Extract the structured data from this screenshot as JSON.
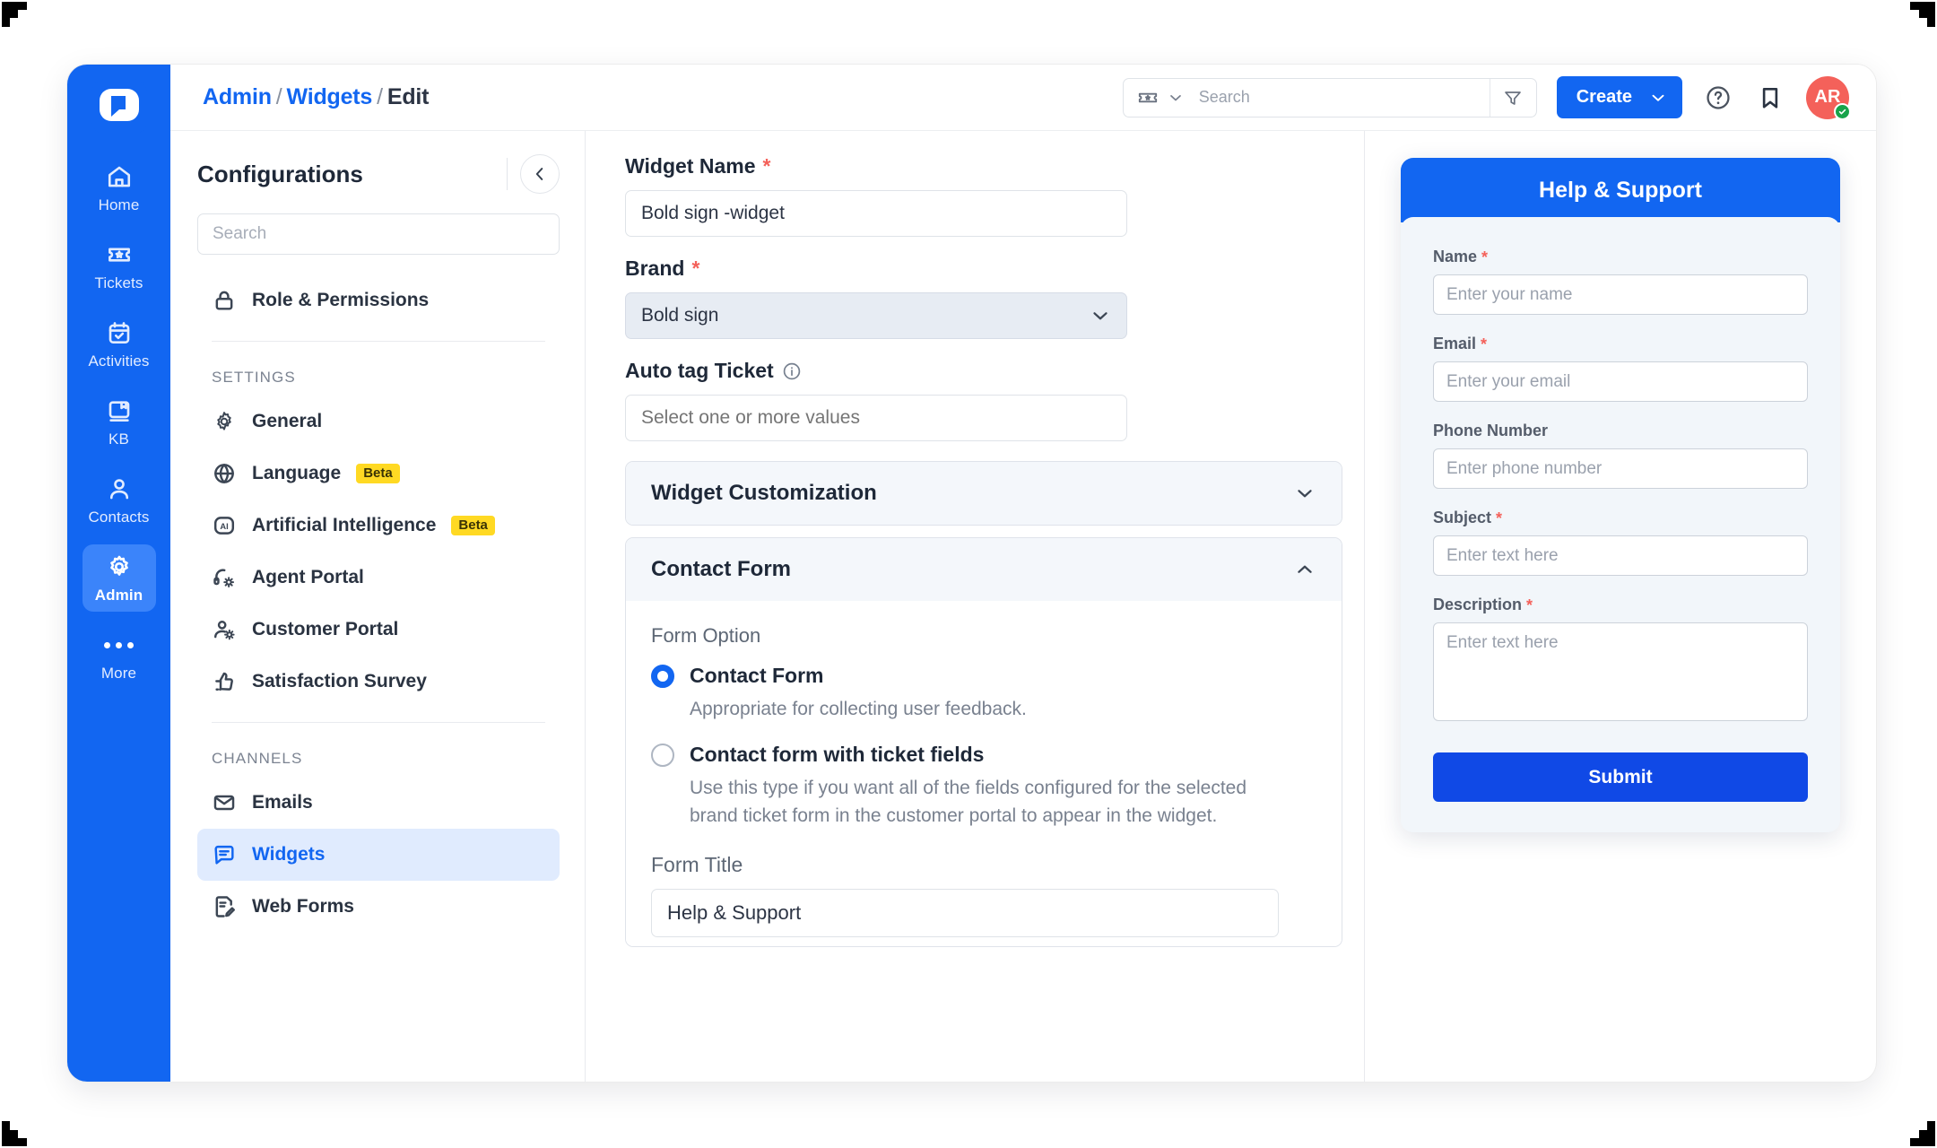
{
  "app": {
    "logo_icon": "chat-bubble-logo-icon",
    "accent_color": "#1266f1",
    "required_color": "#f4615a",
    "beta_badge_color": "#ffd923"
  },
  "rail": {
    "items": [
      {
        "label": "Home",
        "icon": "home-icon",
        "active": false
      },
      {
        "label": "Tickets",
        "icon": "ticket-icon",
        "active": false
      },
      {
        "label": "Activities",
        "icon": "calendar-check-icon",
        "active": false
      },
      {
        "label": "KB",
        "icon": "book-icon",
        "active": false
      },
      {
        "label": "Contacts",
        "icon": "person-icon",
        "active": false
      },
      {
        "label": "Admin",
        "icon": "gear-icon",
        "active": true
      },
      {
        "label": "More",
        "icon": "ellipsis-icon",
        "active": false
      }
    ]
  },
  "topbar": {
    "breadcrumb": {
      "root": "Admin",
      "section": "Widgets",
      "current": "Edit",
      "separator": "/"
    },
    "search": {
      "placeholder": "Search",
      "value": "",
      "type_icon": "ticket-icon",
      "type_chevron_icon": "chevron-down-icon",
      "filter_icon": "filter-icon"
    },
    "create_label": "Create",
    "create_chevron_icon": "chevron-down-icon",
    "help_icon": "question-circle-icon",
    "bookmark_icon": "bookmark-icon",
    "avatar": {
      "initials": "AR",
      "presence": "online",
      "presence_icon": "check-icon"
    }
  },
  "configurations": {
    "title": "Configurations",
    "collapse_icon": "chevron-left-icon",
    "search_placeholder": "Search",
    "search_value": "",
    "top_items": [
      {
        "label": "Role & Permissions",
        "icon": "lock-icon",
        "badge": null,
        "active": false
      }
    ],
    "groups": [
      {
        "title": "SETTINGS",
        "items": [
          {
            "label": "General",
            "icon": "gear-icon",
            "badge": null,
            "active": false
          },
          {
            "label": "Language",
            "icon": "globe-icon",
            "badge": "Beta",
            "active": false
          },
          {
            "label": "Artificial Intelligence",
            "icon": "ai-icon",
            "badge": "Beta",
            "active": false
          },
          {
            "label": "Agent Portal",
            "icon": "headset-gear-icon",
            "badge": null,
            "active": false
          },
          {
            "label": "Customer Portal",
            "icon": "person-gear-icon",
            "badge": null,
            "active": false
          },
          {
            "label": "Satisfaction Survey",
            "icon": "thumbs-up-icon",
            "badge": null,
            "active": false
          }
        ]
      },
      {
        "title": "CHANNELS",
        "items": [
          {
            "label": "Emails",
            "icon": "envelope-icon",
            "badge": null,
            "active": false
          },
          {
            "label": "Widgets",
            "icon": "chat-widget-icon",
            "badge": null,
            "active": true
          },
          {
            "label": "Web Forms",
            "icon": "form-edit-icon",
            "badge": null,
            "active": false
          }
        ]
      }
    ]
  },
  "form": {
    "widget_name": {
      "label": "Widget Name",
      "required": true,
      "value": "Bold sign -widget",
      "placeholder": ""
    },
    "brand": {
      "label": "Brand",
      "required": true,
      "value": "Bold sign",
      "chevron_icon": "chevron-down-icon"
    },
    "auto_tag": {
      "label": "Auto tag Ticket",
      "required": false,
      "info_icon": "info-icon",
      "value": "",
      "placeholder": "Select one or more values"
    },
    "accordions": [
      {
        "title": "Widget Customization",
        "expanded": false,
        "chevron_icon": "chevron-down-icon"
      },
      {
        "title": "Contact Form",
        "expanded": true,
        "chevron_icon": "chevron-up-icon"
      }
    ],
    "contact_form": {
      "form_option_label": "Form Option",
      "options": [
        {
          "title": "Contact Form",
          "desc": "Appropriate for collecting user feedback.",
          "selected": true
        },
        {
          "title": "Contact form with ticket fields",
          "desc": "Use this type if you want all of the fields configured for the selected brand ticket form in the customer portal to appear in the widget.",
          "selected": false
        }
      ],
      "form_title_label": "Form Title",
      "form_title_value": "Help & Support"
    }
  },
  "preview": {
    "header_title": "Help & Support",
    "fields": [
      {
        "label": "Name",
        "required": true,
        "placeholder": "Enter your name",
        "value": "",
        "type": "text"
      },
      {
        "label": "Email",
        "required": true,
        "placeholder": "Enter your email",
        "value": "",
        "type": "text"
      },
      {
        "label": "Phone Number",
        "required": false,
        "placeholder": "Enter phone number",
        "value": "",
        "type": "text"
      },
      {
        "label": "Subject",
        "required": true,
        "placeholder": "Enter text here",
        "value": "",
        "type": "text"
      },
      {
        "label": "Description",
        "required": true,
        "placeholder": "Enter text here",
        "value": "",
        "type": "textarea"
      }
    ],
    "submit_label": "Submit"
  }
}
